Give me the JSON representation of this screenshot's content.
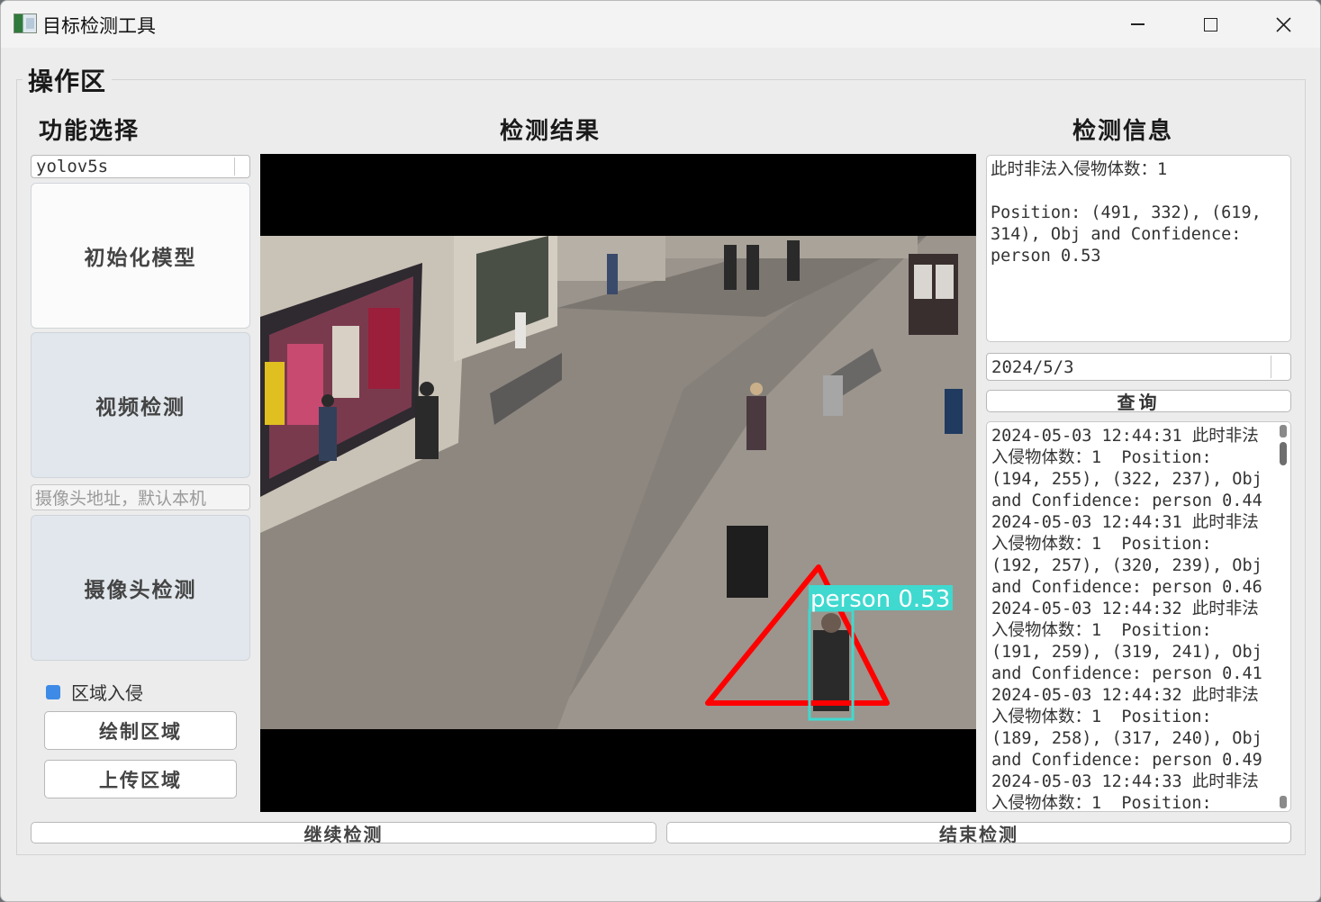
{
  "window": {
    "title": "目标检测工具"
  },
  "group": {
    "title": "操作区"
  },
  "sections": {
    "function": "功能选择",
    "result": "检测结果",
    "info": "检测信息"
  },
  "left": {
    "model_value": "yolov5s",
    "init_label": "初始化模型",
    "video_label": "视频检测",
    "camera_placeholder": "摄像头地址，默认本机",
    "camera_label": "摄像头检测",
    "region_checkbox_label": "区域入侵",
    "draw_label": "绘制区域",
    "upload_label": "上传区域"
  },
  "viewer": {
    "detection_label": "person 0.53",
    "colors": {
      "region": "#ff0000",
      "box": "#3fd9cf"
    }
  },
  "right": {
    "current_info": "此时非法入侵物体数：1\n\nPosition: (491, 332), (619, 314), Obj and Confidence: person 0.53",
    "date_value": "2024/5/3",
    "query_label": "查询",
    "log_lines": [
      "2024-05-03 12:44:31 此时非法",
      "入侵物体数：1  Position:",
      "(194, 255), (322, 237), Obj",
      "and Confidence: person 0.44",
      "2024-05-03 12:44:31 此时非法",
      "入侵物体数：1  Position:",
      "(192, 257), (320, 239), Obj",
      "and Confidence: person 0.46",
      "2024-05-03 12:44:32 此时非法",
      "入侵物体数：1  Position:",
      "(191, 259), (319, 241), Obj",
      "and Confidence: person 0.41",
      "2024-05-03 12:44:32 此时非法",
      "入侵物体数：1  Position:",
      "(189, 258), (317, 240), Obj",
      "and Confidence: person 0.49",
      "2024-05-03 12:44:33 此时非法",
      "入侵物体数：1  Position:"
    ]
  },
  "bottom": {
    "continue_label": "继续检测",
    "stop_label": "结束检测"
  }
}
